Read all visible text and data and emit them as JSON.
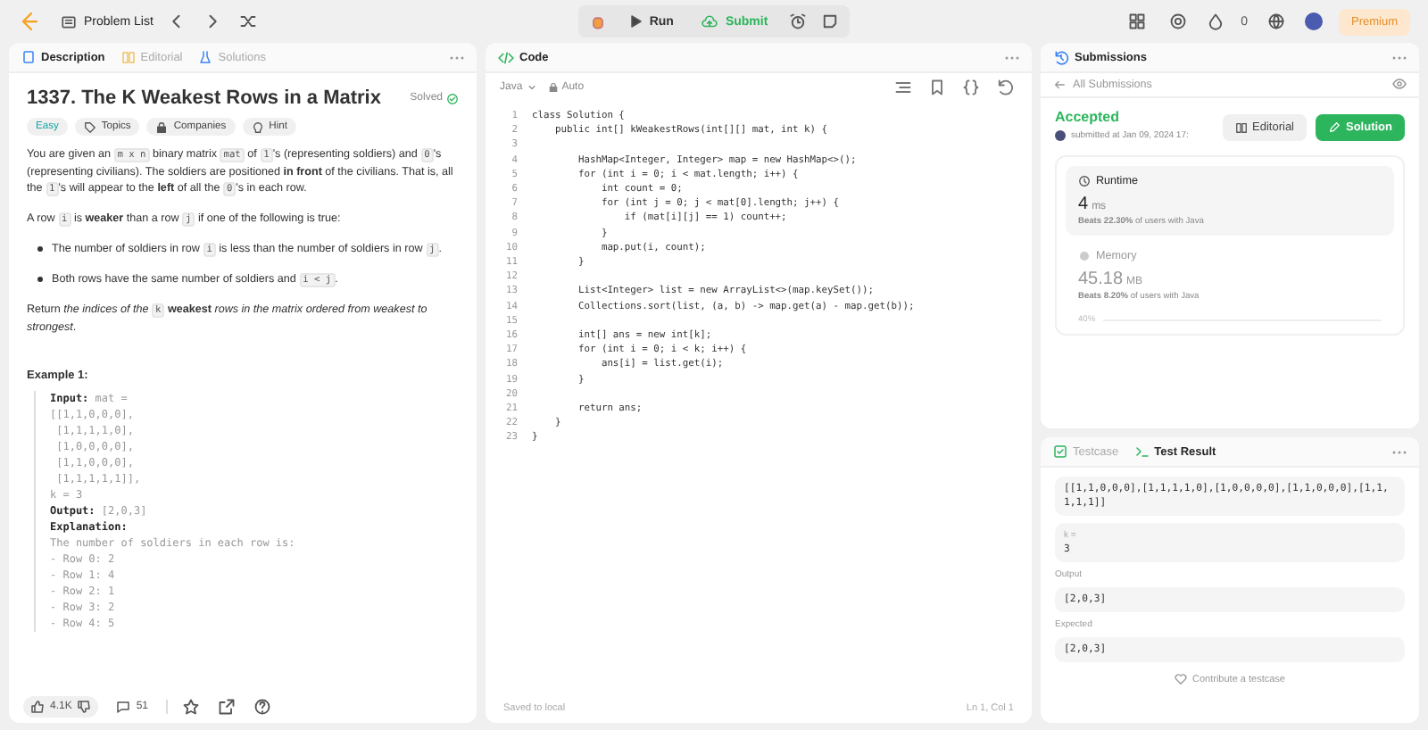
{
  "topbar": {
    "problem_list": "Problem List",
    "run": "Run",
    "submit": "Submit",
    "streak": "0",
    "premium": "Premium"
  },
  "description": {
    "tabs": [
      {
        "label": "Description",
        "selected": true
      },
      {
        "label": "Editorial",
        "selected": false
      },
      {
        "label": "Solutions",
        "selected": false
      }
    ],
    "title": "1337. The K Weakest Rows in a Matrix",
    "status": "Solved",
    "tags": [
      {
        "kind": "difficulty",
        "label": "Easy"
      },
      {
        "kind": "topics",
        "label": "Topics"
      },
      {
        "kind": "companies",
        "label": "Companies"
      },
      {
        "kind": "hint",
        "label": "Hint"
      }
    ],
    "paragraphs": [
      {
        "kind": "para",
        "parts": [
          {
            "kind": "text",
            "text": "You are given an "
          },
          {
            "kind": "code",
            "text": "m x n"
          },
          {
            "kind": "text",
            "text": " binary matrix "
          },
          {
            "kind": "code",
            "text": "mat"
          },
          {
            "kind": "text",
            "text": " of "
          },
          {
            "kind": "code",
            "text": "1"
          },
          {
            "kind": "text",
            "text": "'s (representing soldiers) and "
          },
          {
            "kind": "code",
            "text": "0"
          },
          {
            "kind": "text",
            "text": "'s (representing civilians). The soldiers are positioned **in front** of the civilians. That is, all the "
          },
          {
            "kind": "code",
            "text": "1"
          },
          {
            "kind": "text",
            "text": "'s will appear to the **left** of all the "
          },
          {
            "kind": "code",
            "text": "0"
          },
          {
            "kind": "text",
            "text": "'s in each row."
          }
        ]
      },
      {
        "kind": "para",
        "parts": [
          {
            "kind": "text",
            "text": "A row "
          },
          {
            "kind": "code",
            "text": "i"
          },
          {
            "kind": "text",
            "text": " is **weaker** than a row "
          },
          {
            "kind": "code",
            "text": "j"
          },
          {
            "kind": "text",
            "text": " if one of the following is true:"
          }
        ]
      },
      {
        "kind": "bullet",
        "parts": [
          {
            "kind": "text",
            "text": "The number of soldiers in row "
          },
          {
            "kind": "code",
            "text": "i"
          },
          {
            "kind": "text",
            "text": " is less than the number of soldiers in row "
          },
          {
            "kind": "code",
            "text": "j"
          },
          {
            "kind": "text",
            "text": "."
          }
        ]
      },
      {
        "kind": "bullet",
        "parts": [
          {
            "kind": "text",
            "text": "Both rows have the same number of soldiers and "
          },
          {
            "kind": "code",
            "text": "i < j"
          },
          {
            "kind": "text",
            "text": "."
          }
        ]
      },
      {
        "kind": "para",
        "parts": [
          {
            "kind": "text",
            "text": "Return *the indices of the* "
          },
          {
            "kind": "code",
            "text": "k"
          },
          {
            "kind": "text",
            "text": " **weakest** *rows in the matrix ordered from weakest to strongest*."
          }
        ]
      }
    ],
    "example_title": "Example 1:",
    "example_lines": [
      "**Input:** mat =",
      "[[1,1,0,0,0],",
      " [1,1,1,1,0],",
      " [1,0,0,0,0],",
      " [1,1,0,0,0],",
      " [1,1,1,1,1]],",
      "k = 3",
      "**Output:** [2,0,3]",
      "**Explanation:**",
      "The number of soldiers in each row is: ",
      "- Row 0: 2",
      "- Row 1: 4",
      "- Row 2: 1",
      "- Row 3: 2",
      "- Row 4: 5"
    ],
    "likes": "4.1K",
    "comments": "51"
  },
  "code": {
    "title": "Code",
    "language": "Java",
    "mode": "Auto",
    "lines": [
      {
        "number": "1",
        "text": "class Solution {"
      },
      {
        "number": "2",
        "text": "    public int[] kWeakestRows(int[][] mat, int k) {"
      },
      {
        "number": "3"
      },
      {
        "number": "4",
        "text": "        HashMap<Integer, Integer> map = new HashMap<>();"
      },
      {
        "number": "5",
        "text": "        for (int i = 0; i < mat.length; i++) {"
      },
      {
        "number": "6",
        "text": "            int count = 0;"
      },
      {
        "number": "7",
        "text": "            for (int j = 0; j < mat[0].length; j++) {"
      },
      {
        "number": "8",
        "text": "                if (mat[i][j] == 1) count++;"
      },
      {
        "number": "9",
        "text": "            }"
      },
      {
        "number": "10",
        "text": "            map.put(i, count);"
      },
      {
        "number": "11",
        "text": "        }"
      },
      {
        "number": "12"
      },
      {
        "number": "13",
        "text": "        List<Integer> list = new ArrayList<>(map.keySet());"
      },
      {
        "number": "14",
        "text": "        Collections.sort(list, (a, b) -> map.get(a) - map.get(b));"
      },
      {
        "number": "15"
      },
      {
        "number": "16",
        "text": "        int[] ans = new int[k];"
      },
      {
        "number": "17",
        "text": "        for (int i = 0; i < k; i++) {"
      },
      {
        "number": "18",
        "text": "            ans[i] = list.get(i);"
      },
      {
        "number": "19",
        "text": "        }"
      },
      {
        "number": "20"
      },
      {
        "number": "21",
        "text": "        return ans;"
      },
      {
        "number": "22",
        "text": "    }"
      },
      {
        "number": "23",
        "text": "}"
      }
    ],
    "saved": "Saved to local",
    "cursor": "Ln 1, Col 1"
  },
  "submissions": {
    "title": "Submissions",
    "back": "All Submissions",
    "result": "Accepted",
    "submitted": "submitted at Jan 09, 2024 17:",
    "editorial": "Editorial",
    "solution": "Solution",
    "runtime": {
      "label": "Runtime",
      "value": "4",
      "unit": "ms",
      "beats": "**Beats 22.30%** of users with Java"
    },
    "memory": {
      "label": "Memory",
      "value": "45.18",
      "unit": "MB",
      "beats": "**Beats 8.20%** of users with Java"
    },
    "chart_tick": "40%"
  },
  "tests": {
    "tabs": [
      {
        "label": "Testcase",
        "selected": false
      },
      {
        "label": "Test Result",
        "selected": true
      }
    ],
    "mat_value": "[[1,1,0,0,0],[1,1,1,1,0],[1,0,0,0,0],[1,1,0,0,0],[1,1,1,1,1]]",
    "k_label": "k =",
    "k_value": "3",
    "output_label": "Output",
    "output_value": "[2,0,3]",
    "expected_label": "Expected",
    "expected_value": "[2,0,3]",
    "contribute": "Contribute a testcase"
  }
}
